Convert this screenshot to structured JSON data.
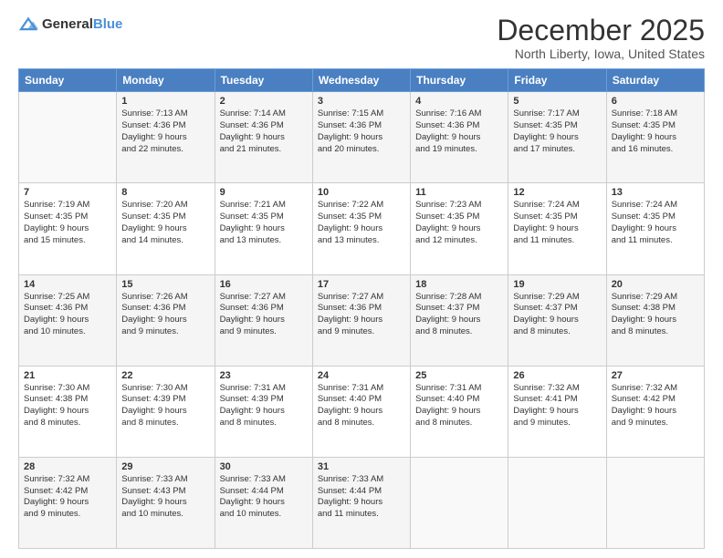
{
  "logo": {
    "general": "General",
    "blue": "Blue"
  },
  "header": {
    "title": "December 2025",
    "subtitle": "North Liberty, Iowa, United States"
  },
  "weekdays": [
    "Sunday",
    "Monday",
    "Tuesday",
    "Wednesday",
    "Thursday",
    "Friday",
    "Saturday"
  ],
  "weeks": [
    [
      {
        "day": "",
        "info": ""
      },
      {
        "day": "1",
        "info": "Sunrise: 7:13 AM\nSunset: 4:36 PM\nDaylight: 9 hours\nand 22 minutes."
      },
      {
        "day": "2",
        "info": "Sunrise: 7:14 AM\nSunset: 4:36 PM\nDaylight: 9 hours\nand 21 minutes."
      },
      {
        "day": "3",
        "info": "Sunrise: 7:15 AM\nSunset: 4:36 PM\nDaylight: 9 hours\nand 20 minutes."
      },
      {
        "day": "4",
        "info": "Sunrise: 7:16 AM\nSunset: 4:36 PM\nDaylight: 9 hours\nand 19 minutes."
      },
      {
        "day": "5",
        "info": "Sunrise: 7:17 AM\nSunset: 4:35 PM\nDaylight: 9 hours\nand 17 minutes."
      },
      {
        "day": "6",
        "info": "Sunrise: 7:18 AM\nSunset: 4:35 PM\nDaylight: 9 hours\nand 16 minutes."
      }
    ],
    [
      {
        "day": "7",
        "info": "Sunrise: 7:19 AM\nSunset: 4:35 PM\nDaylight: 9 hours\nand 15 minutes."
      },
      {
        "day": "8",
        "info": "Sunrise: 7:20 AM\nSunset: 4:35 PM\nDaylight: 9 hours\nand 14 minutes."
      },
      {
        "day": "9",
        "info": "Sunrise: 7:21 AM\nSunset: 4:35 PM\nDaylight: 9 hours\nand 13 minutes."
      },
      {
        "day": "10",
        "info": "Sunrise: 7:22 AM\nSunset: 4:35 PM\nDaylight: 9 hours\nand 13 minutes."
      },
      {
        "day": "11",
        "info": "Sunrise: 7:23 AM\nSunset: 4:35 PM\nDaylight: 9 hours\nand 12 minutes."
      },
      {
        "day": "12",
        "info": "Sunrise: 7:24 AM\nSunset: 4:35 PM\nDaylight: 9 hours\nand 11 minutes."
      },
      {
        "day": "13",
        "info": "Sunrise: 7:24 AM\nSunset: 4:35 PM\nDaylight: 9 hours\nand 11 minutes."
      }
    ],
    [
      {
        "day": "14",
        "info": "Sunrise: 7:25 AM\nSunset: 4:36 PM\nDaylight: 9 hours\nand 10 minutes."
      },
      {
        "day": "15",
        "info": "Sunrise: 7:26 AM\nSunset: 4:36 PM\nDaylight: 9 hours\nand 9 minutes."
      },
      {
        "day": "16",
        "info": "Sunrise: 7:27 AM\nSunset: 4:36 PM\nDaylight: 9 hours\nand 9 minutes."
      },
      {
        "day": "17",
        "info": "Sunrise: 7:27 AM\nSunset: 4:36 PM\nDaylight: 9 hours\nand 9 minutes."
      },
      {
        "day": "18",
        "info": "Sunrise: 7:28 AM\nSunset: 4:37 PM\nDaylight: 9 hours\nand 8 minutes."
      },
      {
        "day": "19",
        "info": "Sunrise: 7:29 AM\nSunset: 4:37 PM\nDaylight: 9 hours\nand 8 minutes."
      },
      {
        "day": "20",
        "info": "Sunrise: 7:29 AM\nSunset: 4:38 PM\nDaylight: 9 hours\nand 8 minutes."
      }
    ],
    [
      {
        "day": "21",
        "info": "Sunrise: 7:30 AM\nSunset: 4:38 PM\nDaylight: 9 hours\nand 8 minutes."
      },
      {
        "day": "22",
        "info": "Sunrise: 7:30 AM\nSunset: 4:39 PM\nDaylight: 9 hours\nand 8 minutes."
      },
      {
        "day": "23",
        "info": "Sunrise: 7:31 AM\nSunset: 4:39 PM\nDaylight: 9 hours\nand 8 minutes."
      },
      {
        "day": "24",
        "info": "Sunrise: 7:31 AM\nSunset: 4:40 PM\nDaylight: 9 hours\nand 8 minutes."
      },
      {
        "day": "25",
        "info": "Sunrise: 7:31 AM\nSunset: 4:40 PM\nDaylight: 9 hours\nand 8 minutes."
      },
      {
        "day": "26",
        "info": "Sunrise: 7:32 AM\nSunset: 4:41 PM\nDaylight: 9 hours\nand 9 minutes."
      },
      {
        "day": "27",
        "info": "Sunrise: 7:32 AM\nSunset: 4:42 PM\nDaylight: 9 hours\nand 9 minutes."
      }
    ],
    [
      {
        "day": "28",
        "info": "Sunrise: 7:32 AM\nSunset: 4:42 PM\nDaylight: 9 hours\nand 9 minutes."
      },
      {
        "day": "29",
        "info": "Sunrise: 7:33 AM\nSunset: 4:43 PM\nDaylight: 9 hours\nand 10 minutes."
      },
      {
        "day": "30",
        "info": "Sunrise: 7:33 AM\nSunset: 4:44 PM\nDaylight: 9 hours\nand 10 minutes."
      },
      {
        "day": "31",
        "info": "Sunrise: 7:33 AM\nSunset: 4:44 PM\nDaylight: 9 hours\nand 11 minutes."
      },
      {
        "day": "",
        "info": ""
      },
      {
        "day": "",
        "info": ""
      },
      {
        "day": "",
        "info": ""
      }
    ]
  ]
}
